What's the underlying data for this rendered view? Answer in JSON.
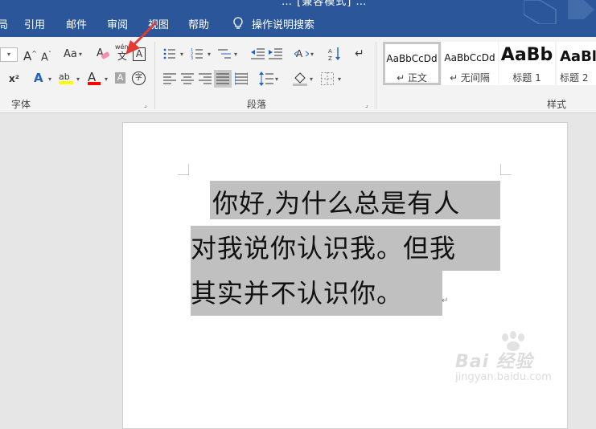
{
  "titlebar": {
    "title_fragment": "… [兼容模式] …",
    "tabs": [
      "局",
      "引用",
      "邮件",
      "审阅",
      "视图",
      "帮助"
    ],
    "tell_me": "操作说明搜索"
  },
  "ribbon": {
    "font_group": {
      "label": "字体",
      "font_size_value": "",
      "grow_font": "A",
      "shrink_font": "A",
      "change_case": "Aa",
      "clear_formatting": "A",
      "phonetic_guide_top": "wén",
      "phonetic_guide_bottom": "文",
      "char_border": "A",
      "superscript": "x²",
      "text_effects": "A",
      "highlight": "ab",
      "font_color": "A",
      "char_shading": "A",
      "enclose_char": "字",
      "highlight_color": "#ffff00",
      "font_color_color": "#ff0000"
    },
    "paragraph_group": {
      "label": "段落"
    },
    "styles_group": {
      "label": "样式",
      "styles": [
        {
          "sample": "AaBbCcDd",
          "name": "↵ 正文"
        },
        {
          "sample": "AaBbCcDd",
          "name": "↵ 无间隔"
        },
        {
          "sample": "AaBb",
          "name": "标题 1"
        },
        {
          "sample": "AaBl",
          "name": "标题 2"
        }
      ]
    }
  },
  "document": {
    "lines": [
      "你好,为什么总是有人",
      "对我说你认识我。但我",
      "其实并不认识你。"
    ],
    "paragraph_mark": "↵",
    "selection_color": "#c0c0c0"
  },
  "watermark": {
    "main": "Bai 经验",
    "sub": "jingyan.baidu.com"
  },
  "colors": {
    "titlebar": "#2b579a",
    "ribbon": "#f3f3f3",
    "arrow": "#e53935"
  }
}
